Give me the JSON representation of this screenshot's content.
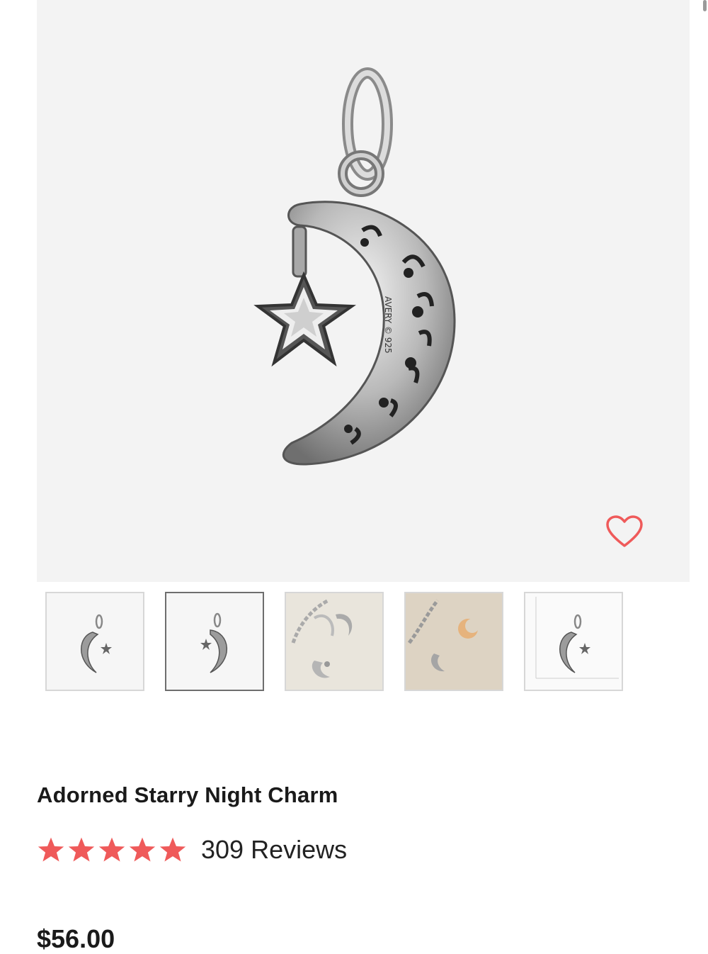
{
  "product": {
    "title": "Adorned Starry Night Charm",
    "rating": 5,
    "rating_max": 5,
    "reviews_label": "309 Reviews",
    "price": "$56.00",
    "engraving": "AVERY © 925"
  },
  "gallery": {
    "selected_index": 1,
    "favorite_icon": "heart-outline-icon",
    "thumbnails": [
      {
        "name": "moon-charm-front"
      },
      {
        "name": "moon-charm-back"
      },
      {
        "name": "charm-on-bracelet-silver"
      },
      {
        "name": "charm-on-bracelet-gold"
      },
      {
        "name": "charm-size-scale"
      }
    ]
  },
  "colors": {
    "accent": "#ef5a5a",
    "hero_bg": "#f3f3f3",
    "text": "#1a1a1a"
  }
}
